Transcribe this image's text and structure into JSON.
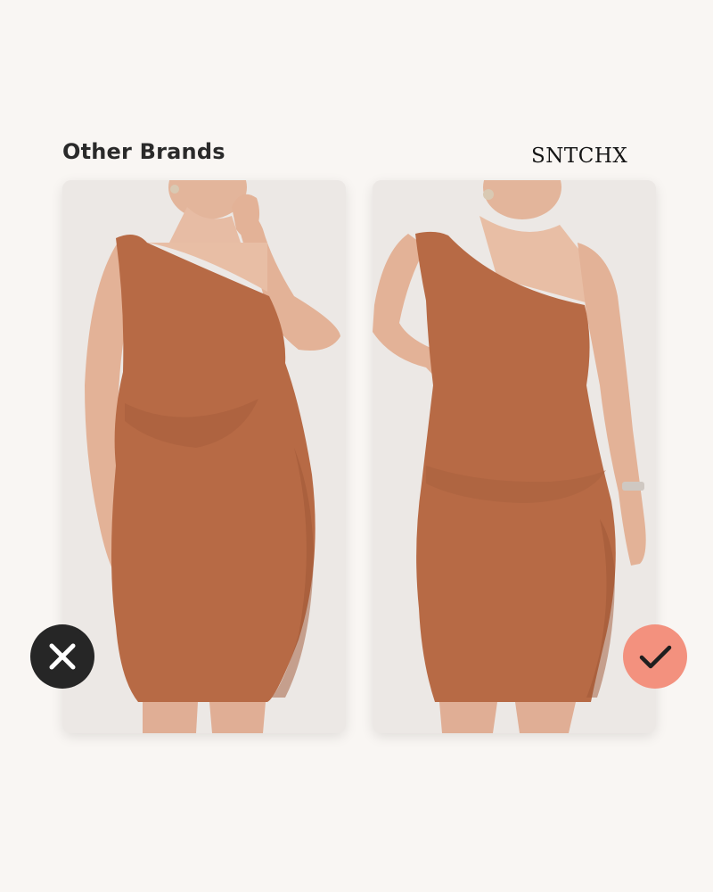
{
  "labels": {
    "left": "Other Brands",
    "right": "SNTCHX"
  },
  "cards": [
    {
      "side": "left",
      "verdict": "bad",
      "icon": "x-icon"
    },
    {
      "side": "right",
      "verdict": "good",
      "icon": "checkmark-icon"
    }
  ],
  "colors": {
    "background": "#f9f6f3",
    "dress": "#b76a45",
    "x_badge": "#262626",
    "check_badge": "#f3917e"
  }
}
